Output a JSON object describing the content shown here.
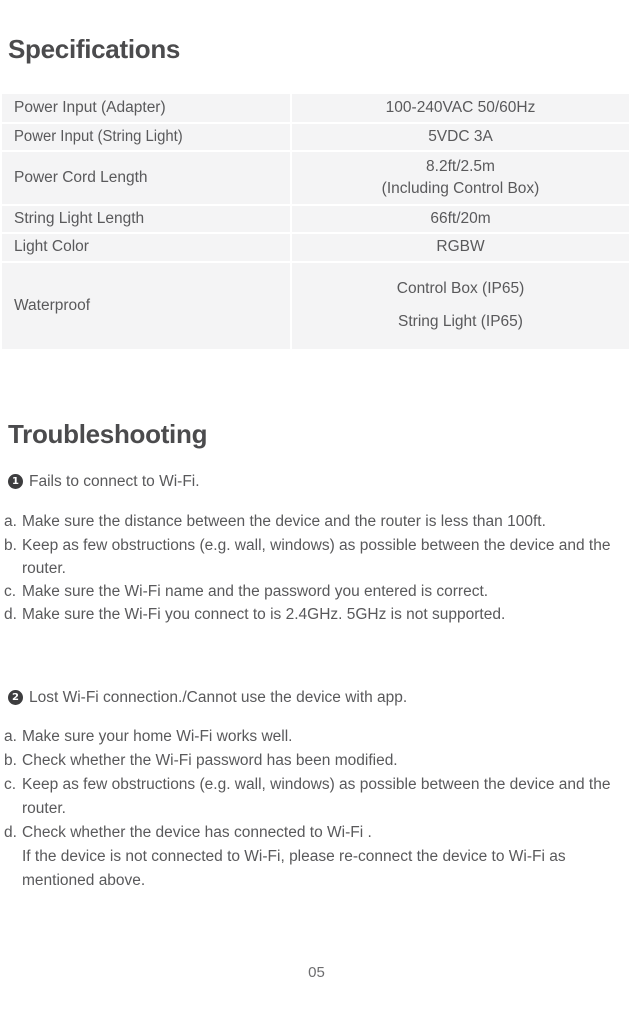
{
  "document": {
    "page_number": "05"
  },
  "specifications": {
    "title": "Specifications",
    "rows": [
      {
        "label": "Power Input (Adapter)",
        "value": "100-240VAC 50/60Hz"
      },
      {
        "label": "Power Input (String Light)",
        "value": "5VDC 3A"
      },
      {
        "label": "Power Cord Length",
        "value_line1": "8.2ft/2.5m",
        "value_line2": "(Including Control Box)"
      },
      {
        "label": "String Light Length",
        "value": "66ft/20m"
      },
      {
        "label": "Light Color",
        "value": "RGBW"
      },
      {
        "label": "Waterproof",
        "value_line1": "Control Box (IP65)",
        "value_line2": "String Light (IP65)"
      }
    ]
  },
  "troubleshooting": {
    "title": "Troubleshooting",
    "sections": [
      {
        "badge": "1",
        "question": "Fails to connect to Wi-Fi.",
        "items": [
          {
            "marker": "a.",
            "text": "Make sure the distance between the device and the router is less than 100ft."
          },
          {
            "marker": "b.",
            "text": "Keep as few obstructions (e.g. wall, windows) as possible between the device and the router."
          },
          {
            "marker": "c.",
            "text": "Make sure the Wi-Fi name and the password you entered is correct."
          },
          {
            "marker": "d.",
            "text": "Make sure the Wi-Fi you connect to is 2.4GHz. 5GHz is not supported."
          }
        ]
      },
      {
        "badge": "2",
        "question": "Lost Wi-Fi connection./Cannot use the device with app.",
        "items": [
          {
            "marker": "a.",
            "text": "Make sure your home Wi-Fi works well."
          },
          {
            "marker": "b.",
            "text": "Check whether the Wi-Fi password has been modified."
          },
          {
            "marker": "c.",
            "text": "Keep as few obstructions (e.g. wall, windows) as possible between the device and the router."
          },
          {
            "marker": "d.",
            "text": "Check whether the device has connected to Wi-Fi .",
            "text2": "If the device is not connected to Wi-Fi, please re-connect the device to Wi-Fi as mentioned above."
          }
        ]
      }
    ]
  },
  "colors": {
    "text": "#59595b",
    "heading": "#4b4b4d",
    "table_cell_bg": "#f4f4f5",
    "badge_bg": "#3d3d3f"
  }
}
